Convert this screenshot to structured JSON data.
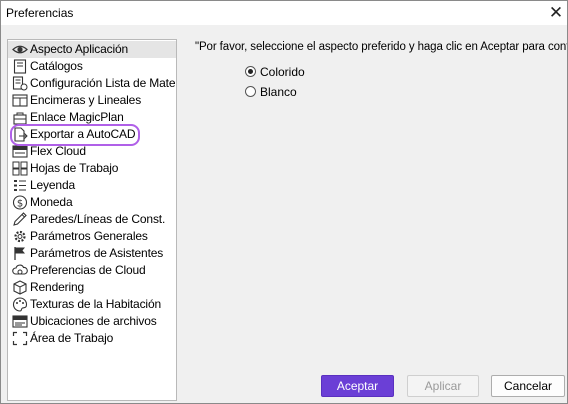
{
  "window": {
    "title": "Preferencias"
  },
  "sidebar": {
    "items": [
      {
        "label": "Aspecto Aplicación",
        "icon": "eye-icon"
      },
      {
        "label": "Catálogos",
        "icon": "catalog-icon"
      },
      {
        "label": "Configuración Lista de Materia",
        "icon": "material-list-icon"
      },
      {
        "label": "Encimeras y Lineales",
        "icon": "countertop-icon"
      },
      {
        "label": "Enlace MagicPlan",
        "icon": "magicplan-icon"
      },
      {
        "label": "Exportar a AutoCAD",
        "icon": "export-autocad-icon"
      },
      {
        "label": "Flex Cloud",
        "icon": "flex-cloud-icon"
      },
      {
        "label": "Hojas de Trabajo",
        "icon": "worksheet-icon"
      },
      {
        "label": "Leyenda",
        "icon": "legend-icon"
      },
      {
        "label": "Moneda",
        "icon": "currency-icon"
      },
      {
        "label": "Paredes/Líneas de Const.",
        "icon": "pencil-icon"
      },
      {
        "label": "Parámetros Generales",
        "icon": "gear-icon"
      },
      {
        "label": "Parámetros de Asistentes",
        "icon": "flag-icon"
      },
      {
        "label": "Preferencias de Cloud",
        "icon": "cloud-gear-icon"
      },
      {
        "label": "Rendering",
        "icon": "cube-icon"
      },
      {
        "label": "Texturas de la Habitación",
        "icon": "palette-icon"
      },
      {
        "label": "Ubicaciones de archivos",
        "icon": "file-locations-icon"
      },
      {
        "label": "Área de Trabajo",
        "icon": "workspace-icon"
      }
    ],
    "selected_index": 0,
    "highlighted_index": 5
  },
  "main": {
    "instruction": "\"Por favor, seleccione el aspecto preferido y haga clic en Aceptar para continu",
    "options": [
      {
        "label": "Colorido",
        "checked": true
      },
      {
        "label": "Blanco",
        "checked": false
      }
    ]
  },
  "buttons": {
    "accept": "Aceptar",
    "apply": "Aplicar",
    "cancel": "Cancelar"
  },
  "colors": {
    "accent": "#6b3fd6",
    "highlight": "#b060e8",
    "selected_row": "#e5e5e5"
  }
}
